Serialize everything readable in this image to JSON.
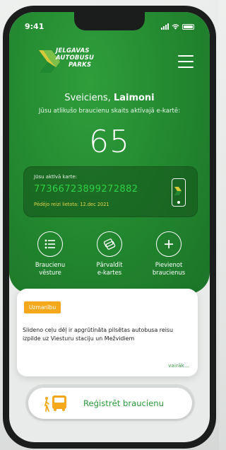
{
  "status_bar": {
    "time": "9:41"
  },
  "brand": {
    "line1": "JELGAVAS",
    "line2": "AUTOBUSU",
    "line3": "PARKS"
  },
  "greeting": {
    "prefix": "Sveiciens, ",
    "name": "Laimoni"
  },
  "rides": {
    "subtitle": "Jūsu atlikušo braucienu skaits aktīvajā e-kartē:",
    "count": "65"
  },
  "active_card": {
    "label": "Jūsu aktīvā karte:",
    "number": "77366723899272882",
    "last_used": "Pēdējo reizi lietota: 12.dec 2021"
  },
  "actions": [
    {
      "label": "Braucienu\nvēsture",
      "icon": "list-icon"
    },
    {
      "label": "Pārvaldīt\ne-kartes",
      "icon": "cards-icon"
    },
    {
      "label": "Pievienot\nbraucienus",
      "icon": "plus-icon"
    }
  ],
  "notice": {
    "badge": "Uzmanību",
    "text": "Slideno ceļu dēļ ir apgrūtināta pilsētas autobusa reisu izpilde uz Viesturu staciju un Mežvidiem",
    "more": "vairāk..."
  },
  "register": {
    "label": "Reģistrēt braucienu",
    "icon": "bus-icon"
  },
  "colors": {
    "primary_green": "#22862f",
    "card_number": "#2fd047",
    "warning": "#f5a91a",
    "accent_text": "#2a9a3a"
  }
}
